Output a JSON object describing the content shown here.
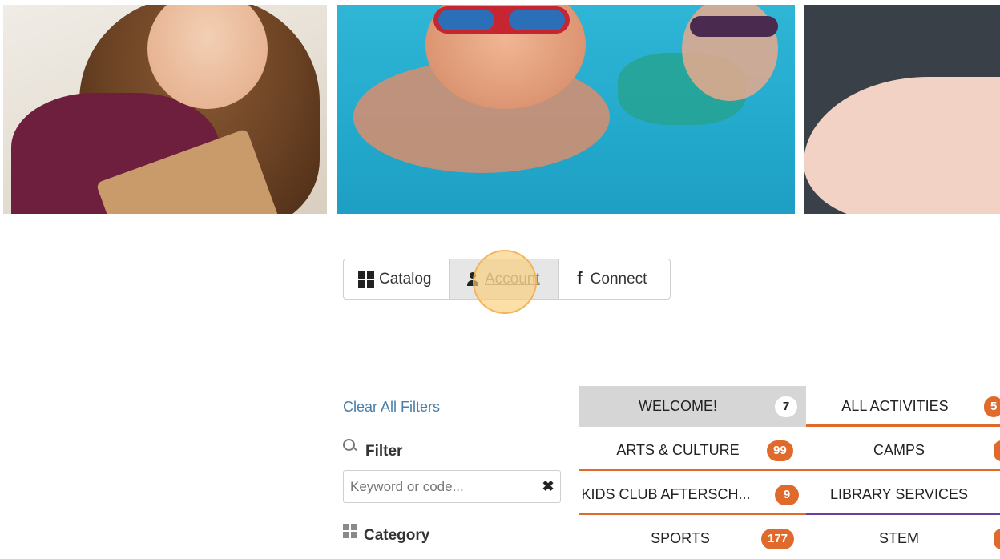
{
  "nav": {
    "catalog_label": "Catalog",
    "account_label": "Account",
    "connect_label": "Connect"
  },
  "sidebar": {
    "clear_filters": "Clear All Filters",
    "filter_heading": "Filter",
    "keyword_placeholder": "Keyword or code...",
    "clear_symbol": "✖",
    "category_heading": "Category"
  },
  "categories": [
    {
      "label": "WELCOME!",
      "count": "7"
    },
    {
      "label": "ALL ACTIVITIES",
      "count": "5"
    },
    {
      "label": "ARTS & CULTURE",
      "count": "99"
    },
    {
      "label": "CAMPS",
      "count": ""
    },
    {
      "label": "KIDS CLUB AFTERSCH...",
      "count": "9"
    },
    {
      "label": "LIBRARY SERVICES",
      "count": ""
    },
    {
      "label": "SPORTS",
      "count": "177"
    },
    {
      "label": "STEM",
      "count": ""
    }
  ],
  "colors": {
    "accent_orange": "#e06a2c",
    "accent_purple": "#6b3fa0",
    "link_blue": "#4a7fa8",
    "selected_gray": "#d6d6d6"
  }
}
